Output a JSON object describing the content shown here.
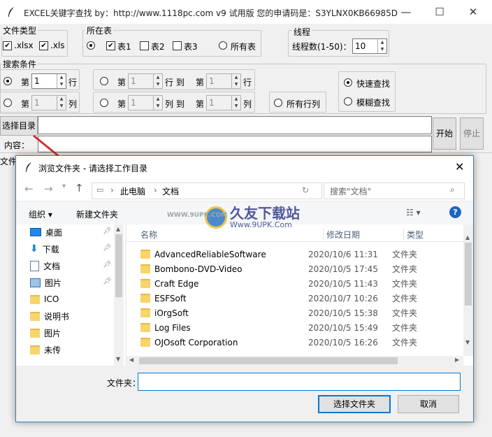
{
  "window": {
    "title": "EXCEL关键字查找   by：http://www.1118pc.com v9 试用版 您的申请码是：S3YLNX0KB66985D",
    "minimize": "—",
    "maximize": "☐",
    "close": "✕"
  },
  "file_type": {
    "label": "文件类型",
    "xlsx_label": ".xlsx",
    "xlsx_checked": true,
    "xls_label": ".xls",
    "xls_checked": true
  },
  "sheet": {
    "label": "所在表",
    "sheet1_label": "表1",
    "sheet1_checked": true,
    "sheet2_label": "表2",
    "sheet3_label": "表3",
    "all_label": "所有表"
  },
  "threads": {
    "label": "线程",
    "field_label": "线程数(1-50)：",
    "value": "10"
  },
  "conditions": {
    "label": "搜索条件",
    "row_prefix": "第",
    "row_value": "1",
    "row_suffix": "行",
    "col_prefix": "第",
    "col_value": "1",
    "col_suffix": "列",
    "range_row_from": "1",
    "range_row_to_text": "行  到",
    "range_row_to_prefix": "第",
    "range_row_to": "1",
    "range_row_to_suffix": "行",
    "range_col_from": "1",
    "range_col_to_text": "列  到",
    "range_col_to_prefix": "第",
    "range_col_to": "1",
    "range_col_to_suffix": "列",
    "all_rows_cols": "所有行列",
    "fast_search": "快速查找",
    "fuzzy_search": "模糊查找"
  },
  "actions": {
    "choose_dir": "选择目录",
    "content_label": "内容：",
    "file_label": "文件",
    "start": "开始",
    "stop": "停止"
  },
  "dialog": {
    "title": "浏览文件夹 - 请选择工作目录",
    "close": "✕",
    "breadcrumb": [
      "此电脑",
      "文档"
    ],
    "search_placeholder": "搜索\"文档\"",
    "organize": "组织 ▾",
    "new_folder": "新建文件夹",
    "help": "?",
    "columns": {
      "name": "名称",
      "date": "修改日期",
      "type": "类型"
    },
    "tree": [
      {
        "label": "桌面",
        "icon": "desktop-icon",
        "pinned": true
      },
      {
        "label": "下载",
        "icon": "download-icon",
        "pinned": true
      },
      {
        "label": "文档",
        "icon": "document-icon",
        "pinned": true
      },
      {
        "label": "图片",
        "icon": "picture-icon",
        "pinned": true
      },
      {
        "label": "ICO",
        "icon": "folder-icon",
        "pinned": false
      },
      {
        "label": "说明书",
        "icon": "folder-icon",
        "pinned": false
      },
      {
        "label": "图片",
        "icon": "folder-icon",
        "pinned": false
      },
      {
        "label": "未传",
        "icon": "folder-icon",
        "pinned": false
      }
    ],
    "files": [
      {
        "name": "AdvancedReliableSoftware",
        "date": "2020/10/6 11:31",
        "type": "文件夹"
      },
      {
        "name": "Bombono-DVD-Video",
        "date": "2020/10/5 17:45",
        "type": "文件夹"
      },
      {
        "name": "Craft Edge",
        "date": "2020/10/5 11:43",
        "type": "文件夹"
      },
      {
        "name": "ESFSoft",
        "date": "2020/10/7 10:26",
        "type": "文件夹"
      },
      {
        "name": "iOrgSoft",
        "date": "2020/10/5 15:38",
        "type": "文件夹"
      },
      {
        "name": "Log Files",
        "date": "2020/10/5 15:49",
        "type": "文件夹"
      },
      {
        "name": "OJOsoft Corporation",
        "date": "2020/10/5 16:26",
        "type": "文件夹"
      }
    ],
    "folder_label": "文件夹：",
    "folder_value": "",
    "select_button": "选择文件夹",
    "cancel_button": "取消"
  },
  "watermark": {
    "site": "久友下载站",
    "url": "Www.9UPK.Com",
    "small": "WWW.9UPK.COM"
  },
  "colors": {
    "accent": "#0078d7",
    "arrow": "#d32f2f",
    "folder": "#f6d56b"
  }
}
